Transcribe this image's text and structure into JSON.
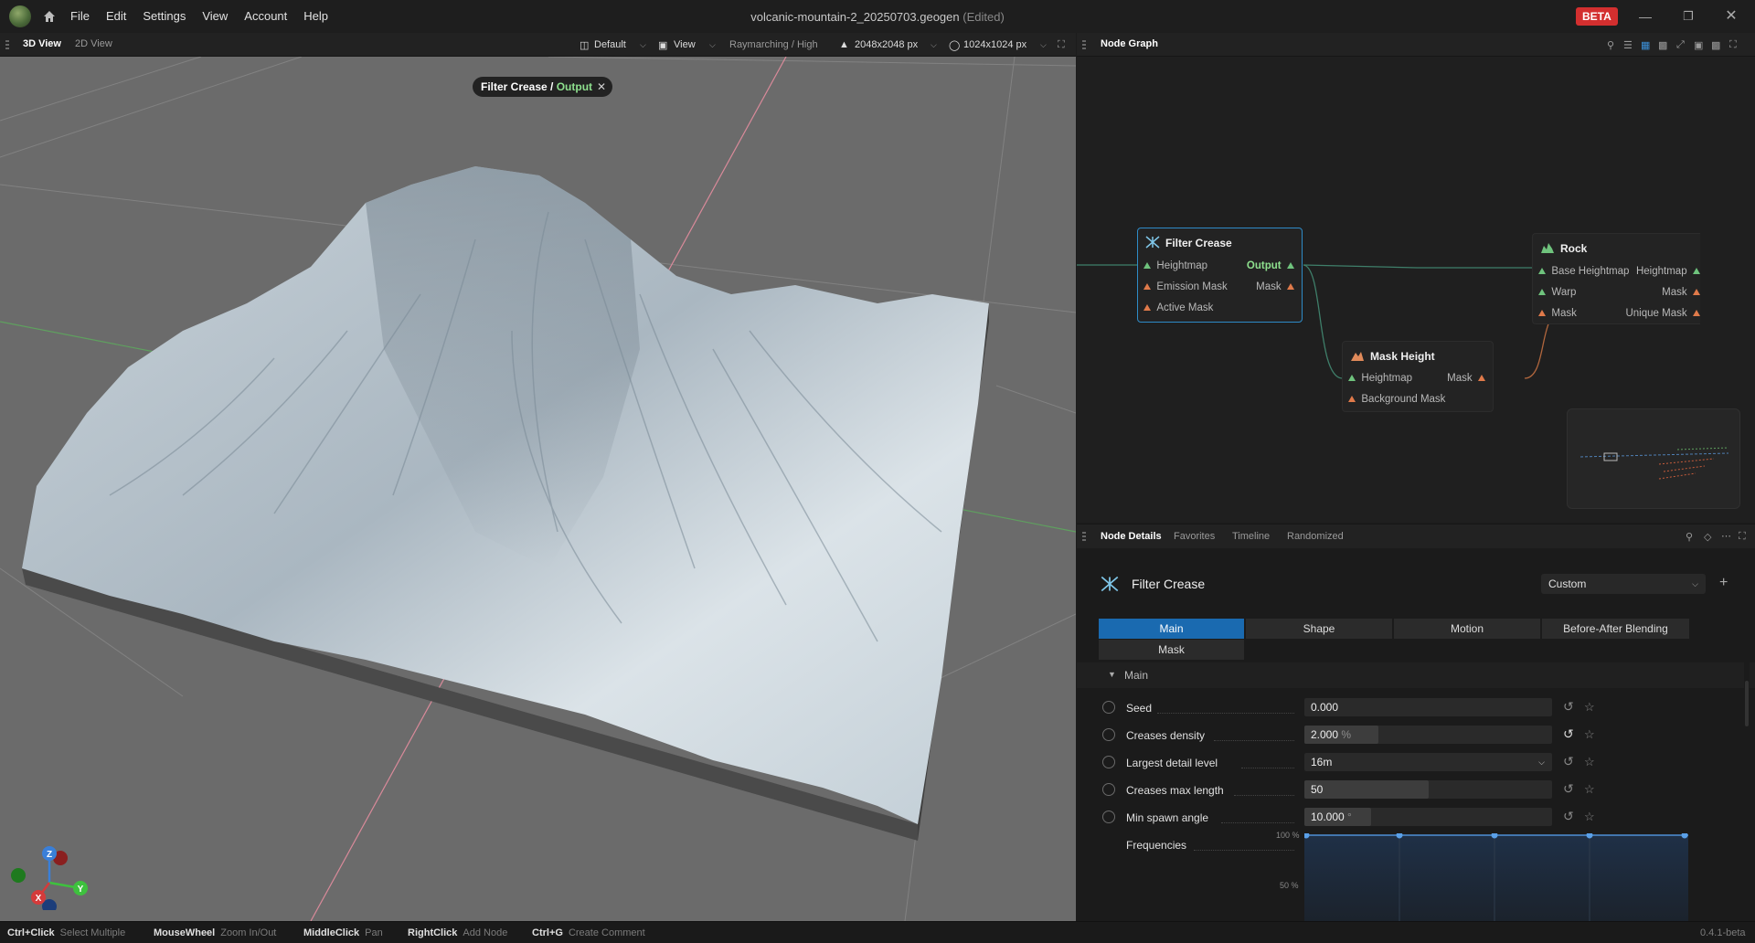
{
  "menu": [
    "File",
    "Edit",
    "Settings",
    "View",
    "Account",
    "Help"
  ],
  "document": {
    "title": "volcanic-mountain-2_20250703.geogen",
    "edited": "(Edited)"
  },
  "badge": "BETA",
  "viewport_tabs": {
    "active": "3D View",
    "inactive": "2D View"
  },
  "viewport_toolbar": {
    "preset": "Default",
    "view": "View",
    "render": "Raymarching / High",
    "res1": "2048x2048 px",
    "res2": "1024x1024 px"
  },
  "breadcrumb": {
    "node": "Filter Crease",
    "sep": " / ",
    "output": "Output"
  },
  "node_graph": {
    "title": "Node Graph",
    "nodes": {
      "filter_crease": {
        "title": "Filter Crease",
        "in1": "Heightmap",
        "in2": "Emission Mask",
        "in3": "Active Mask",
        "out1": "Output",
        "out2": "Mask"
      },
      "mask_height": {
        "title": "Mask Height",
        "in1": "Heightmap",
        "in2": "Background Mask",
        "out1": "Mask"
      },
      "rock": {
        "title": "Rock",
        "in1": "Base Heightmap",
        "in2": "Warp",
        "in3": "Mask",
        "out1": "Heightmap",
        "out2": "Mask",
        "out3": "Unique Mask"
      }
    }
  },
  "details_tabs": [
    "Node Details",
    "Favorites",
    "Timeline",
    "Randomized"
  ],
  "details": {
    "node_name": "Filter Crease",
    "preset": "Custom",
    "param_tabs": [
      "Main",
      "Shape",
      "Motion",
      "Before-After Blending",
      "Mask"
    ],
    "section": "Main",
    "params": {
      "seed": {
        "label": "Seed",
        "value": "0.000"
      },
      "density": {
        "label": "Creases density",
        "value": "2.000",
        "unit": "%"
      },
      "detail": {
        "label": "Largest detail level",
        "value": "16m"
      },
      "maxlen": {
        "label": "Creases max length",
        "value": "50"
      },
      "angle": {
        "label": "Min spawn angle",
        "value": "10.000",
        "unit": "°"
      },
      "freq": {
        "label": "Frequencies",
        "tick100": "100 %",
        "tick50": "50 %"
      }
    }
  },
  "statusbar": [
    {
      "key": "Ctrl+Click",
      "desc": "Select Multiple"
    },
    {
      "key": "MouseWheel",
      "desc": "Zoom In/Out"
    },
    {
      "key": "MiddleClick",
      "desc": "Pan"
    },
    {
      "key": "RightClick",
      "desc": "Add Node"
    },
    {
      "key": "Ctrl+G",
      "desc": "Create Comment"
    }
  ],
  "version": "0.4.1-beta",
  "colors": {
    "accent": "#1a6ab0",
    "selected_node": "#2e8bc7",
    "output": "#8ee08e",
    "beta": "#d32f2f"
  }
}
